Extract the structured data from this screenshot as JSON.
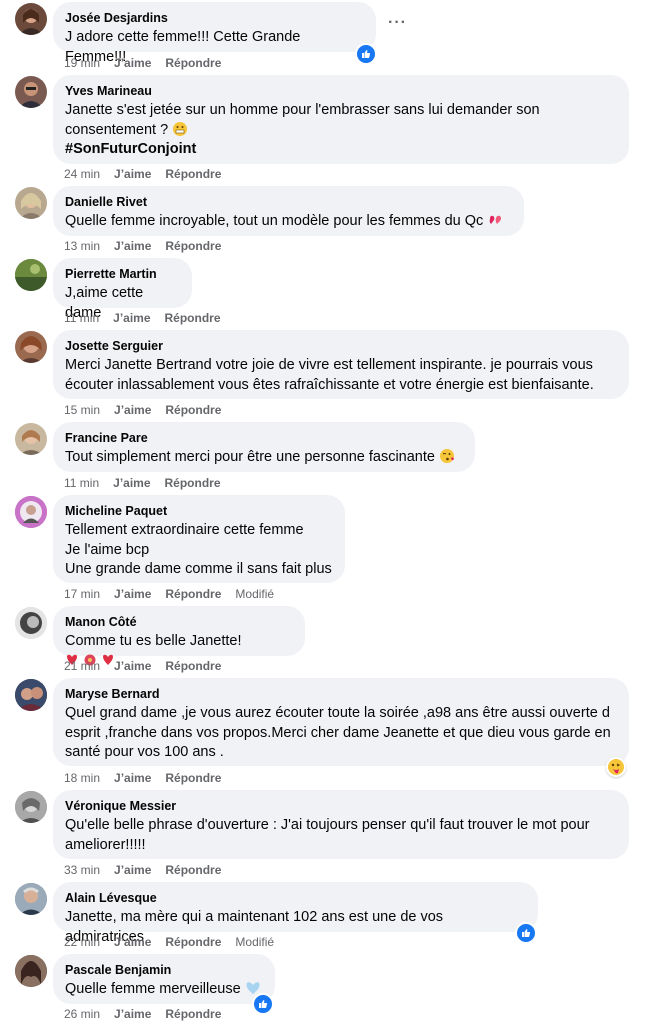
{
  "more_button": "···",
  "comments": [
    {
      "author": "Josée Desjardins",
      "lines": [
        "J adore cette femme!!! Cette Grande Femme!!!"
      ],
      "time": "19 min",
      "like": "J’aime",
      "reply": "Répondre",
      "edited": ""
    },
    {
      "author": "Yves Marineau",
      "lines": [
        "Janette s'est jetée sur un homme pour l'embrasser sans lui demander son",
        "consentement ?",
        "#SonFuturConjoint"
      ],
      "time": "24 min",
      "like": "J’aime",
      "reply": "Répondre",
      "edited": ""
    },
    {
      "author": "Danielle Rivet",
      "lines": [
        "Quelle femme incroyable, tout un modèle pour les femmes du Qc"
      ],
      "time": "13 min",
      "like": "J’aime",
      "reply": "Répondre",
      "edited": ""
    },
    {
      "author": "Pierrette Martin",
      "lines": [
        "J,aime cette dame"
      ],
      "time": "11 min",
      "like": "J’aime",
      "reply": "Répondre",
      "edited": ""
    },
    {
      "author": "Josette Serguier",
      "lines": [
        "Merci Janette Bertrand votre joie de vivre est tellement inspirante. je pourrais vous",
        "écouter inlassablement vous êtes rafraîchissante et votre énergie est bienfaisante."
      ],
      "time": "15 min",
      "like": "J’aime",
      "reply": "Répondre",
      "edited": ""
    },
    {
      "author": "Francine Pare",
      "lines": [
        "Tout simplement merci pour être une personne fascinante"
      ],
      "time": "11 min",
      "like": "J’aime",
      "reply": "Répondre",
      "edited": ""
    },
    {
      "author": "Micheline Paquet",
      "lines": [
        "Tellement extraordinaire cette femme",
        "Je l'aime bcp",
        "Une grande dame comme il sans fait plus"
      ],
      "time": "17 min",
      "like": "J’aime",
      "reply": "Répondre",
      "edited": "Modifié"
    },
    {
      "author": "Manon Côté",
      "lines": [
        "Comme tu es belle Janette!"
      ],
      "time": "21 min",
      "like": "J’aime",
      "reply": "Répondre",
      "edited": ""
    },
    {
      "author": "Maryse Bernard",
      "lines": [
        "Quel grand dame ,je vous aurez écouter toute la soirée ,a98 ans être aussi ouverte d",
        "esprit ,franche dans vos propos.Merci cher dame Jeanette et que dieu vous garde en",
        "santé pour vos 100 ans ."
      ],
      "time": "18 min",
      "like": "J’aime",
      "reply": "Répondre",
      "edited": ""
    },
    {
      "author": "Véronique Messier",
      "lines": [
        "Qu'elle belle phrase d'ouverture : J'ai toujours penser qu'il faut trouver le mot pour",
        "ameliorer!!!!!"
      ],
      "time": "33 min",
      "like": "J’aime",
      "reply": "Répondre",
      "edited": ""
    },
    {
      "author": "Alain Lévesque",
      "lines": [
        "Janette, ma mère qui a maintenant 102 ans est une de vos admiratrices"
      ],
      "time": "22 min",
      "like": "J’aime",
      "reply": "Répondre",
      "edited": "Modifié"
    },
    {
      "author": "Pascale Benjamin",
      "lines": [
        "Quelle femme merveilleuse"
      ],
      "time": "26 min",
      "like": "J’aime",
      "reply": "Répondre",
      "edited": ""
    }
  ]
}
